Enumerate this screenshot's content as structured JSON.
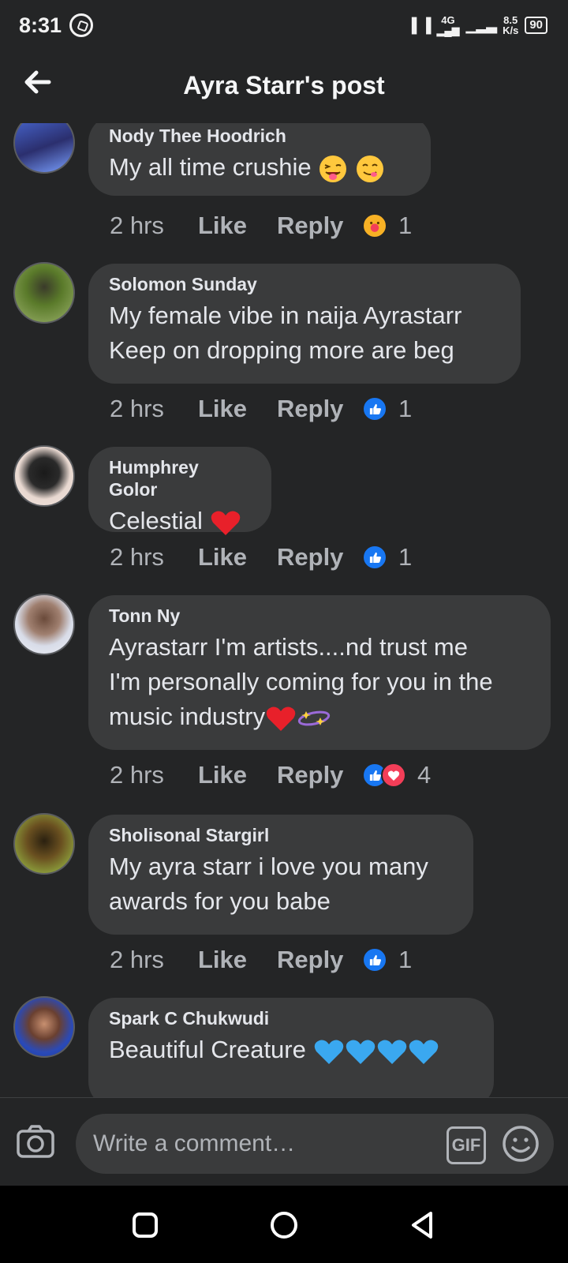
{
  "status_bar": {
    "time": "8:31",
    "network": "4G",
    "speed_value": "8.5",
    "speed_unit": "K/s",
    "battery": "90"
  },
  "header": {
    "title": "Ayra Starr's post"
  },
  "comments": [
    {
      "author": "Nody Thee Hoodrich",
      "lines": [
        "My all time crushie"
      ],
      "time": "2 hrs",
      "like": "Like",
      "reply": "Reply",
      "reactions": [
        "care"
      ],
      "reaction_count": "1"
    },
    {
      "author": "Solomon Sunday",
      "lines": [
        "My female vibe in naija Ayrastarr",
        "Keep on dropping more are beg"
      ],
      "time": "2 hrs",
      "like": "Like",
      "reply": "Reply",
      "reactions": [
        "like"
      ],
      "reaction_count": "1"
    },
    {
      "author": "Humphrey Golor",
      "lines": [
        "Celestial"
      ],
      "time": "2 hrs",
      "like": "Like",
      "reply": "Reply",
      "reactions": [
        "like"
      ],
      "reaction_count": "1"
    },
    {
      "author": "Tonn Ny",
      "lines": [
        "Ayrastarr I'm artists....nd trust me",
        "I'm personally coming for you in the",
        "music industry"
      ],
      "time": "2 hrs",
      "like": "Like",
      "reply": "Reply",
      "reactions": [
        "like",
        "love"
      ],
      "reaction_count": "4"
    },
    {
      "author": "Sholisonal Stargirl",
      "lines": [
        "My ayra starr i love you many",
        "awards for you babe"
      ],
      "time": "2 hrs",
      "like": "Like",
      "reply": "Reply",
      "reactions": [
        "like"
      ],
      "reaction_count": "1"
    },
    {
      "author": "Spark C Chukwudi",
      "lines": [
        "Beautiful Creature"
      ]
    }
  ],
  "composer": {
    "placeholder": "Write a comment…",
    "gif_label": "GIF"
  },
  "colors": {
    "background": "#242526",
    "bubble": "#3a3b3c",
    "like_blue": "#1877f2",
    "love_red": "#f33e58"
  }
}
